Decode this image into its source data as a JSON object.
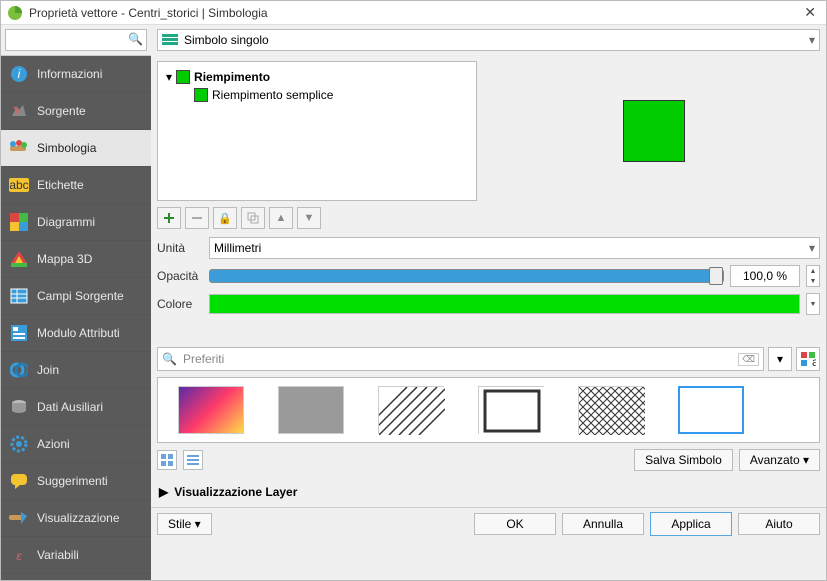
{
  "window": {
    "title": "Proprietà vettore - Centri_storici | Simbologia"
  },
  "sidebar": {
    "search_placeholder": "",
    "items": [
      {
        "id": "informazioni",
        "label": "Informazioni"
      },
      {
        "id": "sorgente",
        "label": "Sorgente"
      },
      {
        "id": "simbologia",
        "label": "Simbologia",
        "active": true
      },
      {
        "id": "etichette",
        "label": "Etichette"
      },
      {
        "id": "diagrammi",
        "label": "Diagrammi"
      },
      {
        "id": "mappa3d",
        "label": "Mappa 3D"
      },
      {
        "id": "campi",
        "label": "Campi Sorgente"
      },
      {
        "id": "modulo",
        "label": "Modulo Attributi"
      },
      {
        "id": "join",
        "label": "Join"
      },
      {
        "id": "aux",
        "label": "Dati Ausiliari"
      },
      {
        "id": "azioni",
        "label": "Azioni"
      },
      {
        "id": "sugger",
        "label": "Suggerimenti"
      },
      {
        "id": "visual",
        "label": "Visualizzazione"
      },
      {
        "id": "variabili",
        "label": "Variabili"
      }
    ]
  },
  "symbol": {
    "mode": "Simbolo singolo",
    "root": "Riempimento",
    "child": "Riempimento semplice",
    "color": "#00cc00"
  },
  "props": {
    "unit_label": "Unità",
    "unit_value": "Millimetri",
    "opacity_label": "Opacità",
    "opacity_value": "100,0 %",
    "color_label": "Colore"
  },
  "favorites": {
    "placeholder": "Preferiti",
    "save_label": "Salva Simbolo",
    "adv_label": "Avanzato"
  },
  "expander": {
    "label": "Visualizzazione Layer"
  },
  "footer": {
    "style": "Stile",
    "ok": "OK",
    "cancel": "Annulla",
    "apply": "Applica",
    "help": "Aiuto"
  }
}
